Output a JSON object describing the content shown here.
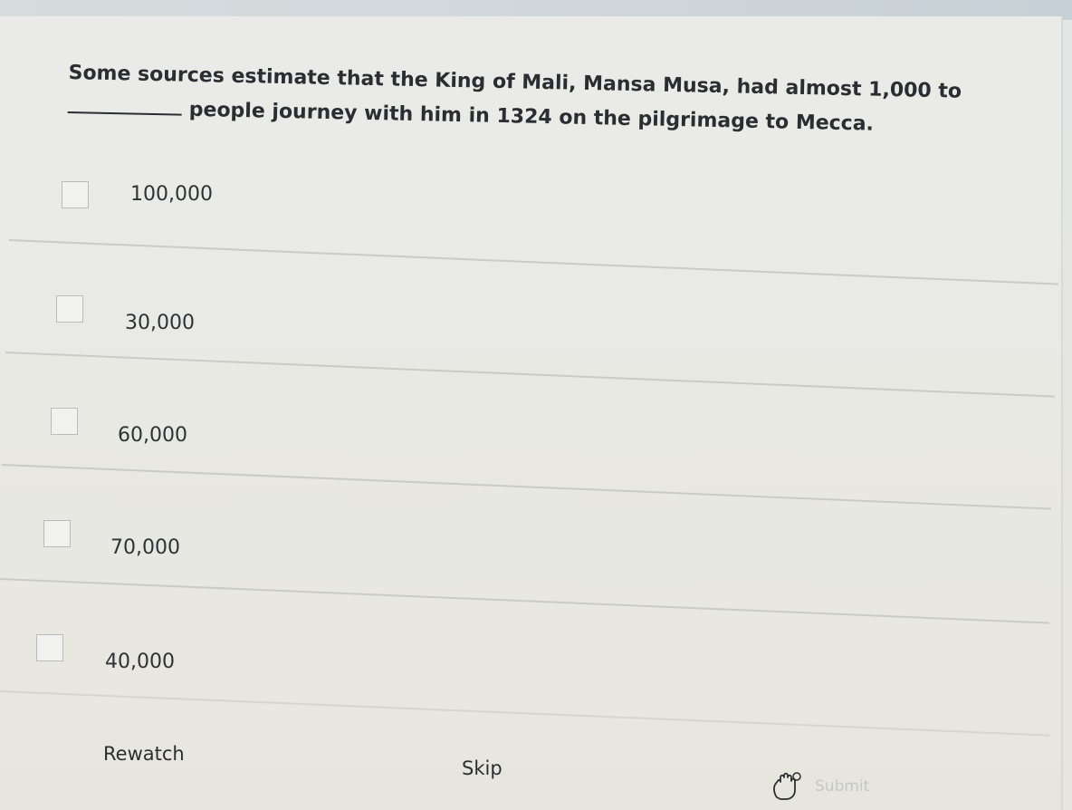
{
  "question": {
    "text_part1": "Some sources estimate that the King of Mali, Mansa Musa, had almost 1,000 to",
    "text_part2": "people journey with him in 1324 on the pilgrimage to Mecca."
  },
  "options": [
    {
      "label": "100,000",
      "checked": false
    },
    {
      "label": "30,000",
      "checked": false
    },
    {
      "label": "60,000",
      "checked": false
    },
    {
      "label": "70,000",
      "checked": false
    },
    {
      "label": "40,000",
      "checked": false
    }
  ],
  "actions": {
    "rewatch_label": "Rewatch",
    "skip_label": "Skip",
    "submit_label": "Submit",
    "submit_icon": "hand-pointer-icon"
  }
}
